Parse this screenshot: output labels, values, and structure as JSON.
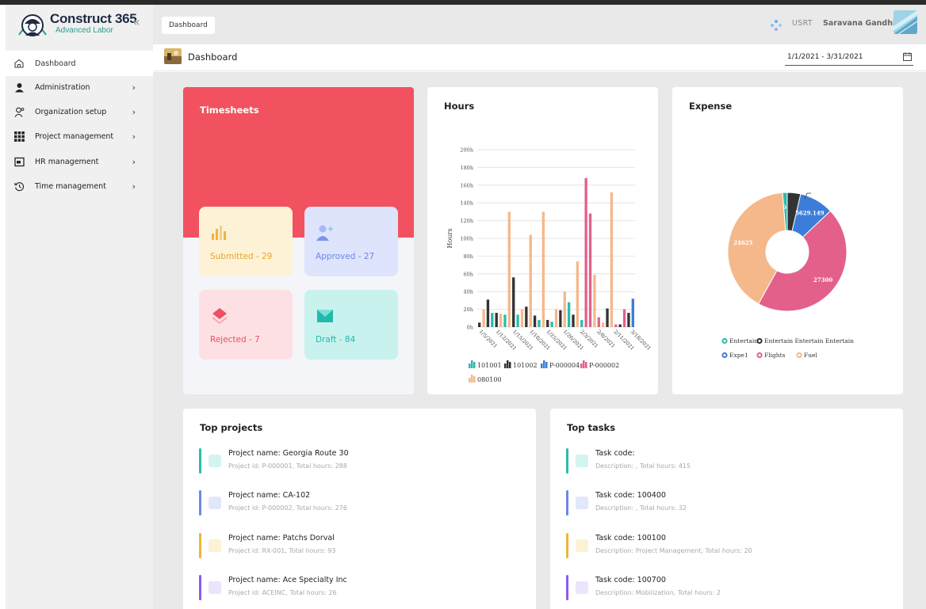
{
  "brand": {
    "title": "Construct 365",
    "subtitle": "Advanced Labor"
  },
  "sidebar": {
    "items": [
      {
        "label": "Dashboard",
        "icon": "home-icon"
      },
      {
        "label": "Administration",
        "icon": "admin-user-icon"
      },
      {
        "label": "Organization setup",
        "icon": "org-user-icon"
      },
      {
        "label": "Project management",
        "icon": "grid-icon"
      },
      {
        "label": "HR management",
        "icon": "id-card-icon"
      },
      {
        "label": "Time management",
        "icon": "history-icon"
      }
    ]
  },
  "topbar": {
    "crumb": "Dashboard",
    "user_code": "USRT",
    "user_name": "Saravana Gandhi"
  },
  "page": {
    "title": "Dashboard",
    "date_range": "1/1/2021 - 3/31/2021"
  },
  "timesheets": {
    "title": "Timesheets",
    "tiles": [
      {
        "label": "Submitted - 29",
        "icon": "bar-chart-icon"
      },
      {
        "label": "Approved - 27",
        "icon": "user-add-icon"
      },
      {
        "label": "Rejected - 7",
        "icon": "diamond-icon"
      },
      {
        "label": "Draft - 84",
        "icon": "draft-envelope-icon"
      }
    ]
  },
  "chart_data": [
    {
      "title": "Hours",
      "type": "bar",
      "ylabel": "Hours",
      "ylim": [
        0,
        200
      ],
      "yticks": [
        "0h",
        "20h",
        "40h",
        "60h",
        "80h",
        "100h",
        "120h",
        "140h",
        "160h",
        "180h",
        "200h"
      ],
      "xtick_labels": [
        "1/5/2021",
        "1/12/2021",
        "1/15/2021",
        "1/18/2021",
        "1/25/2021",
        "1/26/2021",
        "2/3/2021",
        "2/8/2021",
        "2/11/2021",
        "3/18/2021"
      ],
      "series": [
        {
          "name": "101001",
          "color": "#2bbbad"
        },
        {
          "name": "101002",
          "color": "#333333"
        },
        {
          "name": "P-000004",
          "color": "#3b7dd8"
        },
        {
          "name": "P-000002",
          "color": "#e3608a"
        },
        {
          "name": "080100",
          "color": "#f5b88a"
        }
      ],
      "bars": [
        {
          "series": "101002",
          "value": 5
        },
        {
          "series": "080100",
          "value": 20
        },
        {
          "series": "101002",
          "value": 31
        },
        {
          "series": "101001",
          "value": 16
        },
        {
          "series": "101002",
          "value": 16
        },
        {
          "series": "080100",
          "value": 15
        },
        {
          "series": "101001",
          "value": 14
        },
        {
          "series": "080100",
          "value": 130
        },
        {
          "series": "101002",
          "value": 56
        },
        {
          "series": "101001",
          "value": 14
        },
        {
          "series": "080100",
          "value": 20
        },
        {
          "series": "101002",
          "value": 23
        },
        {
          "series": "080100",
          "value": 104
        },
        {
          "series": "101002",
          "value": 13
        },
        {
          "series": "101001",
          "value": 8
        },
        {
          "series": "080100",
          "value": 130
        },
        {
          "series": "101002",
          "value": 8
        },
        {
          "series": "101001",
          "value": 6
        },
        {
          "series": "080100",
          "value": 20
        },
        {
          "series": "101002",
          "value": 19
        },
        {
          "series": "080100",
          "value": 40
        },
        {
          "series": "101001",
          "value": 28
        },
        {
          "series": "101002",
          "value": 14
        },
        {
          "series": "080100",
          "value": 74
        },
        {
          "series": "101001",
          "value": 8
        },
        {
          "series": "P-000002",
          "value": 168
        },
        {
          "series": "P-000002",
          "value": 128
        },
        {
          "series": "080100",
          "value": 59
        },
        {
          "series": "P-000002",
          "value": 11
        },
        {
          "series": "080100",
          "value": 5
        },
        {
          "series": "101002",
          "value": 21
        },
        {
          "series": "080100",
          "value": 152
        },
        {
          "series": "P-000002",
          "value": 3
        },
        {
          "series": "101002",
          "value": 3
        },
        {
          "series": "P-000002",
          "value": 20
        },
        {
          "series": "101002",
          "value": 16
        },
        {
          "series": "P-000004",
          "value": 32
        }
      ]
    },
    {
      "title": "Expense",
      "type": "pie",
      "slices": [
        {
          "name": "Entertain",
          "value": 766.48,
          "label": "766.48",
          "color": "#2bbbad"
        },
        {
          "name": "Entertain Entertain Entertain",
          "value": 2200,
          "label": "",
          "color": "#333333"
        },
        {
          "name": "Expe1",
          "value": 5629.149,
          "label": "5629.149",
          "color": "#3b7dd8"
        },
        {
          "name": "Flights",
          "value": 27300,
          "label": "27300",
          "color": "#e3608a"
        },
        {
          "name": "Fuel",
          "value": 24625,
          "label": "24625",
          "color": "#f5b88a"
        }
      ]
    }
  ],
  "top_projects": {
    "title": "Top projects",
    "items": [
      {
        "line1": "Project name: Georgia Route 30",
        "line2": "Project id: P-000001, Total hours: 288",
        "accent": "#2bbbad",
        "tint": "#d3f4f1"
      },
      {
        "line1": "Project name: CA-102",
        "line2": "Project id: P-000002, Total hours: 276",
        "accent": "#6f86e6",
        "tint": "#e2e8fb"
      },
      {
        "line1": "Project name: Patchs Dorval",
        "line2": "Project id: RX-001, Total hours: 93",
        "accent": "#f0b43a",
        "tint": "#fdf1d6"
      },
      {
        "line1": "Project name: Ace Specialty Inc",
        "line2": "Project id: ACEINC, Total hours: 26",
        "accent": "#8a5cf0",
        "tint": "#ebe4fc"
      }
    ]
  },
  "top_tasks": {
    "title": "Top tasks",
    "items": [
      {
        "line1": "Task code:",
        "line2": "Description: , Total hours: 415",
        "accent": "#2bbbad",
        "tint": "#d3f4f1"
      },
      {
        "line1": "Task code: 100400",
        "line2": "Description: , Total hours: 32",
        "accent": "#6f86e6",
        "tint": "#e2e8fb"
      },
      {
        "line1": "Task code: 100100",
        "line2": "Description: Project Management, Total hours: 20",
        "accent": "#f0b43a",
        "tint": "#fdf1d6"
      },
      {
        "line1": "Task code: 100700",
        "line2": "Description: Mobilization, Total hours: 2",
        "accent": "#8a5cf0",
        "tint": "#ebe4fc"
      }
    ]
  }
}
